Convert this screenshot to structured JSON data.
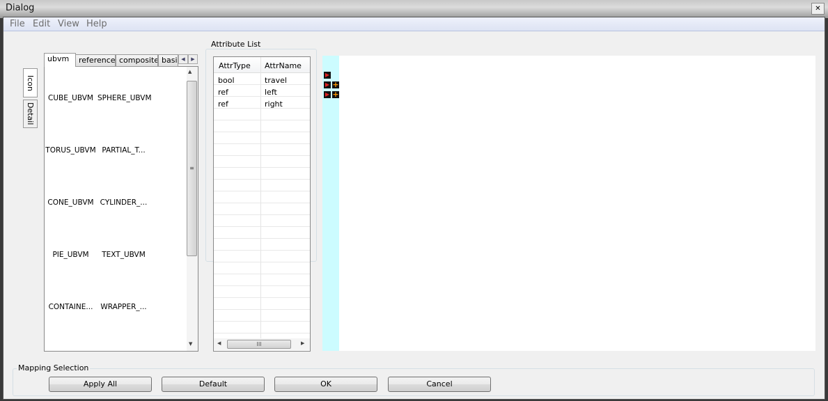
{
  "window": {
    "title": "Dialog",
    "close_icon": "close-icon"
  },
  "menu": [
    "File",
    "Edit",
    "View",
    "Help"
  ],
  "side_tabs": [
    "Icon",
    "Detail"
  ],
  "tabs": [
    "ubvm",
    "reference",
    "composite",
    "basic"
  ],
  "icon_items": [
    "CUBE_UBVM",
    "SPHERE_UBVM",
    "TORUS_UBVM",
    "PARTIAL_T...",
    "CONE_UBVM",
    "CYLINDER_...",
    "PIE_UBVM",
    "TEXT_UBVM",
    "CONTAINE...",
    "WRAPPER_..."
  ],
  "attribute_list": {
    "title": "Attribute List",
    "columns": [
      "AttrType",
      "AttrName"
    ],
    "rows": [
      [
        "bool",
        "travel"
      ],
      [
        "ref",
        "left"
      ],
      [
        "ref",
        "right"
      ]
    ]
  },
  "mapping": {
    "title": "Mapping Selection",
    "buttons": [
      "Apply All",
      "Default",
      "OK",
      "Cancel"
    ]
  },
  "colors": {
    "canvas_strip": "#ccfcff",
    "play_icon": "#dd2222",
    "plus_icon": "#ff9900"
  }
}
